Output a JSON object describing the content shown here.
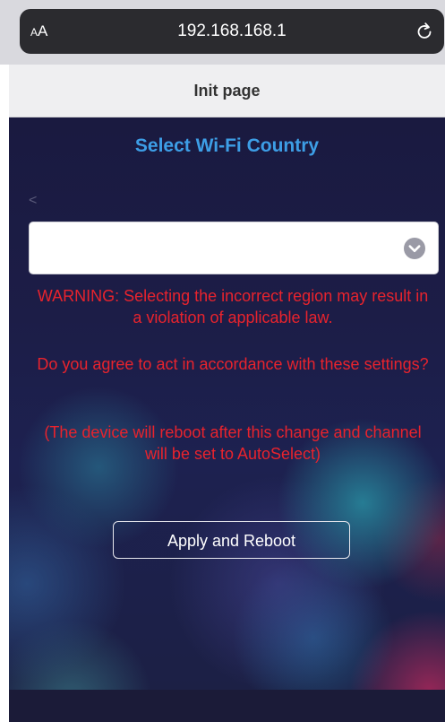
{
  "browser": {
    "aa_big": "A",
    "aa_small": "A",
    "url": "192.168.168.1",
    "reload_icon": "reload-icon"
  },
  "header": {
    "title": "Init page"
  },
  "main": {
    "section_title": "Select Wi-Fi Country",
    "back_glyph": "<",
    "country_select": {
      "value": "",
      "arrow_icon": "chevron-down-circle-icon"
    },
    "warnings": [
      "WARNING: Selecting the incorrect region may result in a violation of applicable law.",
      "Do you agree to act in accordance with these settings?",
      "(The device will reboot after this change and channel will be set to AutoSelect)"
    ],
    "apply_button": "Apply and Reboot"
  },
  "colors": {
    "title_blue": "#3d9ee6",
    "warning_red": "#e8232d",
    "background_dark": "#1c1d47"
  }
}
